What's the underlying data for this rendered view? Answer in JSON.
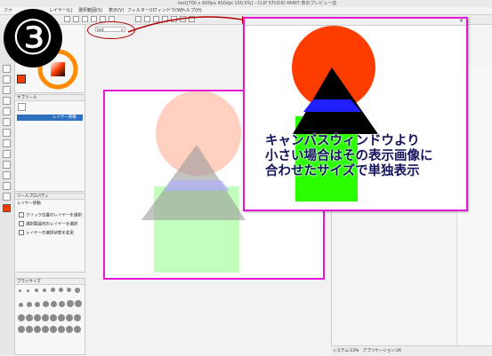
{
  "window": {
    "title": "test[700 x 600px 450dpi 100.0%] - CLIP STUDIO PAINT 表示プレビュー窓"
  },
  "menu": [
    "ファ",
    "レイヤー(L)",
    "選択範囲(S)",
    "表示(V)",
    "フィルター(I)",
    "ウィンドウ(W)",
    "ヘルプ(H)"
  ],
  "step_badge": "③",
  "canvas_tab": {
    "label": "test",
    "close": "×"
  },
  "subtool": {
    "header": "サブツール",
    "selected_label": "レイヤー移動"
  },
  "tool_property": {
    "header": "ツールプロパティ",
    "subheader": "レイヤー移動",
    "options": [
      "クリック位置のレイヤーを選択",
      "選択範囲内のレイヤーを選択",
      "レイヤーの選択状態を変更"
    ]
  },
  "brush_size": {
    "header": "ブラシサイズ"
  },
  "caption_lines": [
    "キャンバスウィンドウより",
    "小さい場合はその表示画像に",
    "合わせたサイズで単独表示"
  ],
  "statusbar": {
    "text": "システム:13%　アプリケーション:26"
  },
  "colors": {
    "highlight": "#e815d8",
    "circle": "#ff3c00",
    "triangle": "#000000",
    "triangle_overlap": "#2020ff",
    "square": "#2aff00",
    "caption": "#15155e",
    "badge": "#000000",
    "badge_text": "#ffffff",
    "selection": "#2f6fc0"
  }
}
